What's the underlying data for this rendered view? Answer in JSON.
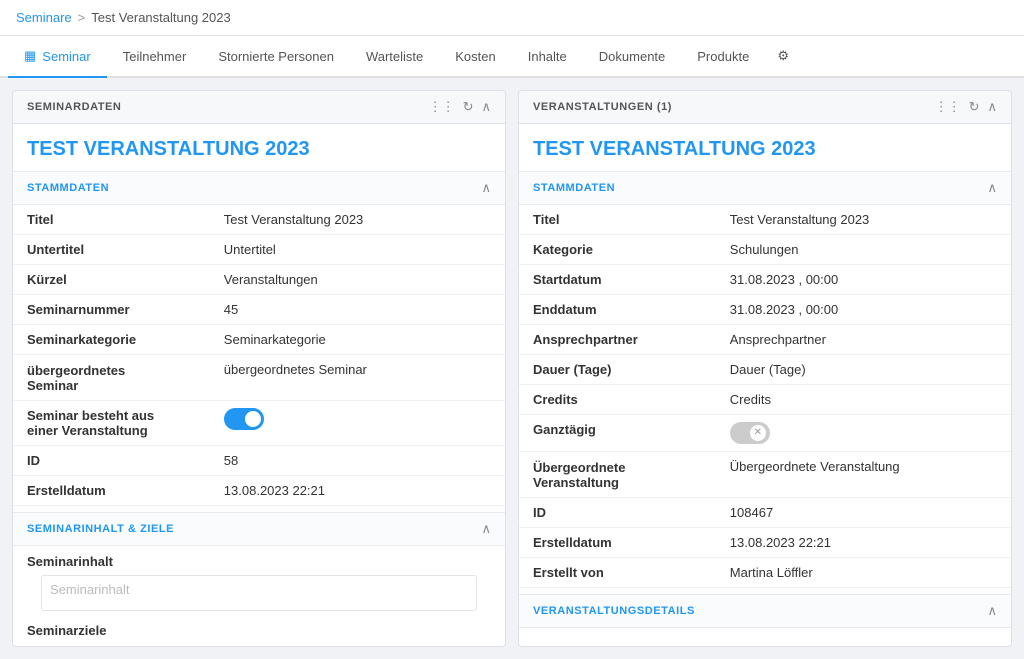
{
  "breadcrumb": {
    "parent_label": "Seminare",
    "current_label": "Test Veranstaltung 2023",
    "sep": ">"
  },
  "tabs": [
    {
      "id": "seminar",
      "label": "Seminar",
      "icon": "table-icon",
      "active": true
    },
    {
      "id": "teilnehmer",
      "label": "Teilnehmer",
      "active": false
    },
    {
      "id": "stornierte",
      "label": "Stornierte Personen",
      "active": false
    },
    {
      "id": "warteliste",
      "label": "Warteliste",
      "active": false
    },
    {
      "id": "kosten",
      "label": "Kosten",
      "active": false
    },
    {
      "id": "inhalte",
      "label": "Inhalte",
      "active": false
    },
    {
      "id": "dokumente",
      "label": "Dokumente",
      "active": false
    },
    {
      "id": "produkte",
      "label": "Produkte",
      "active": false
    }
  ],
  "left_panel": {
    "header": "SEMINARDATEN",
    "entity_title": "TEST VERANSTALTUNG 2023",
    "stammdaten": {
      "section_title": "STAMMDATEN",
      "fields": [
        {
          "label": "Titel",
          "value": "Test Veranstaltung 2023",
          "placeholder": false
        },
        {
          "label": "Untertitel",
          "value": "Untertitel",
          "placeholder": true
        },
        {
          "label": "Kürzel",
          "value": "Veranstaltungen",
          "placeholder": false
        },
        {
          "label": "Seminarnummer",
          "value": "45",
          "placeholder": false
        },
        {
          "label": "Seminarkategorie",
          "value": "Seminarkategorie",
          "placeholder": true
        },
        {
          "label": "übergeordnetes Seminar",
          "value": "übergeordnetes Seminar",
          "placeholder": true
        }
      ],
      "toggle_label": "Seminar besteht aus einer Veranstaltung",
      "toggle_state": "on",
      "id_label": "ID",
      "id_value": "58",
      "erstelldatum_label": "Erstelldatum",
      "erstelldatum_value": "13.08.2023 22:21"
    },
    "seminarinhalt": {
      "section_title": "SEMINARINHALT & ZIELE",
      "inhalt_label": "Seminarinhalt",
      "inhalt_placeholder": "Seminarinhalt",
      "ziele_label": "Seminarziele"
    }
  },
  "right_panel": {
    "header": "VERANSTALTUNGEN (1)",
    "entity_title": "TEST VERANSTALTUNG 2023",
    "stammdaten": {
      "section_title": "STAMMDATEN",
      "fields": [
        {
          "label": "Titel",
          "value": "Test Veranstaltung 2023",
          "placeholder": false
        },
        {
          "label": "Kategorie",
          "value": "Schulungen",
          "placeholder": false
        },
        {
          "label": "Startdatum",
          "value": "31.08.2023 ,  00:00",
          "placeholder": false
        },
        {
          "label": "Enddatum",
          "value": "31.08.2023 ,  00:00",
          "placeholder": false
        },
        {
          "label": "Ansprechpartner",
          "value": "Ansprechpartner",
          "placeholder": true
        },
        {
          "label": "Dauer (Tage)",
          "value": "Dauer (Tage)",
          "placeholder": true
        },
        {
          "label": "Credits",
          "value": "Credits",
          "placeholder": true
        }
      ],
      "ganztaegig_label": "Ganztägig",
      "toggle_state": "off",
      "uebergeordnete_label": "Übergeordnete Veranstaltung",
      "uebergeordnete_value": "Übergeordnete Veranstaltung",
      "id_label": "ID",
      "id_value": "108467",
      "erstelldatum_label": "Erstelldatum",
      "erstelldatum_value": "13.08.2023 22:21",
      "erstellt_von_label": "Erstellt von",
      "erstellt_von_value": "Martina Löffler"
    },
    "veranstaltungsdetails": {
      "section_title": "VERANSTALTUNGSDETAILS"
    }
  }
}
